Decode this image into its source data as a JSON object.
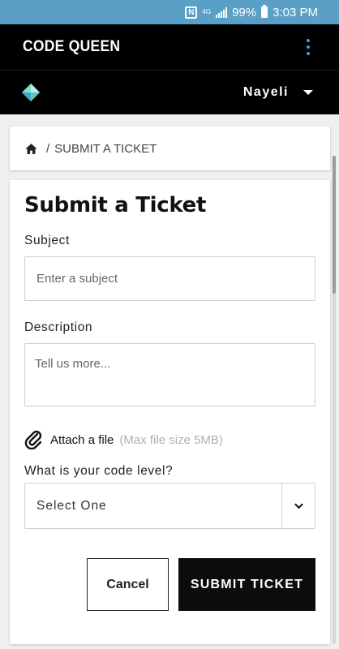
{
  "status_bar": {
    "battery_percent": "99%",
    "time": "3:03 PM",
    "nfc_label": "N",
    "network_label": "4G",
    "background_color": "#5a9fc6"
  },
  "app_bar": {
    "title": "CODE QUEEN",
    "menu_icon": "more-vert-icon",
    "menu_color": "#4a9fd4"
  },
  "user_bar": {
    "logo_icon": "diamond-logo-icon",
    "user_name": "Nayeli",
    "dropdown_icon": "caret-down-icon"
  },
  "breadcrumb": {
    "home_icon": "home-icon",
    "separator": "/",
    "current": "SUBMIT A TICKET"
  },
  "form": {
    "title": "Submit a Ticket",
    "subject_label": "Subject",
    "subject_placeholder": "Enter a subject",
    "subject_value": "",
    "description_label": "Description",
    "description_placeholder": "Tell us more...",
    "description_value": "",
    "attach_icon": "paperclip-icon",
    "attach_label": "Attach a file",
    "attach_hint": "(Max file size 5MB)",
    "level_label": "What is your code level?",
    "level_selected": "Select One",
    "level_icon": "chevron-down-icon",
    "cancel_label": "Cancel",
    "submit_label": "SUBMIT TICKET"
  }
}
